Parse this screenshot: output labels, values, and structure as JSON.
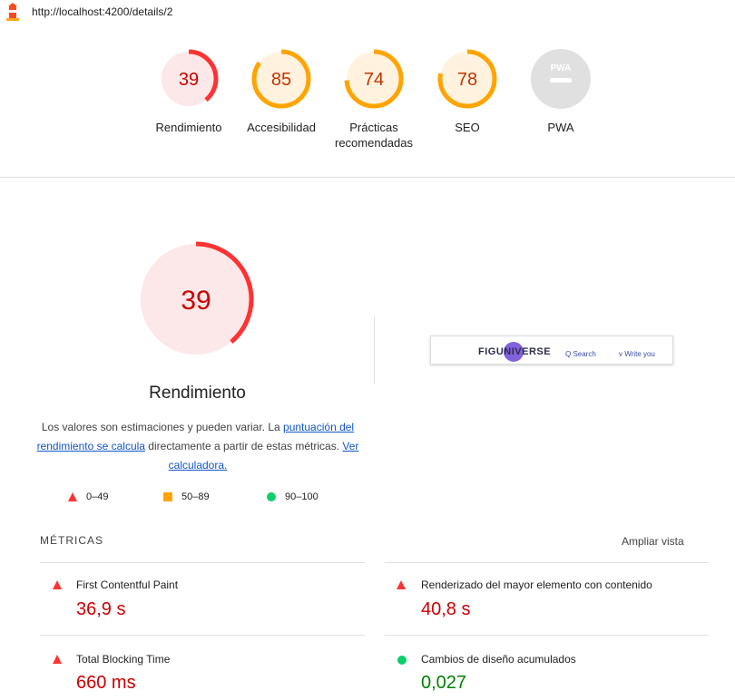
{
  "browser": {
    "url": "http://localhost:4200/details/2"
  },
  "gauges": [
    {
      "id": "rendimiento",
      "score": "39",
      "label": "Rendimiento",
      "fraction": 0.39,
      "color": "#ff3333",
      "bg": "#fce8e8",
      "text_color": "#c00"
    },
    {
      "id": "accesibilidad",
      "score": "85",
      "label": "Accesibilidad",
      "fraction": 0.85,
      "color": "#ffa400",
      "bg": "#fff3e0",
      "text_color": "#c33300"
    },
    {
      "id": "practicas",
      "score": "74",
      "label": "Prácticas recomendadas",
      "fraction": 0.74,
      "color": "#ffa400",
      "bg": "#fff3e0",
      "text_color": "#c33300"
    },
    {
      "id": "seo",
      "score": "78",
      "label": "SEO",
      "fraction": 0.78,
      "color": "#ffa400",
      "bg": "#fff3e0",
      "text_color": "#c33300"
    },
    {
      "id": "pwa",
      "score": "PWA",
      "label": "PWA",
      "fraction": 0,
      "color": "#cccccc",
      "bg": "#e0e0e0",
      "text_color": "#fff"
    }
  ],
  "performance": {
    "score": "39",
    "fraction": 0.39,
    "title": "Rendimiento",
    "desc_part1": "Los valores son estimaciones y pueden variar. La ",
    "desc_link1": "puntuación del rendimiento se calcula",
    "desc_part2": " directamente a partir de estas métricas. ",
    "desc_link2": "Ver calculadora."
  },
  "legend": {
    "fail": "0–49",
    "average": "50–89",
    "pass": "90–100"
  },
  "screenshot": {
    "brand": "FIGUNIVERSE",
    "search": "Q Search",
    "write": "v Write you"
  },
  "metrics": {
    "section_title": "MÉTRICAS",
    "expand_label": "Ampliar vista",
    "items": [
      {
        "label": "First Contentful Paint",
        "value": "36,9 s",
        "status": "fail"
      },
      {
        "label": "Renderizado del mayor elemento con contenido",
        "value": "40,8 s",
        "status": "fail"
      },
      {
        "label": "Total Blocking Time",
        "value": "660 ms",
        "status": "fail"
      },
      {
        "label": "Cambios de diseño acumulados",
        "value": "0,027",
        "status": "pass"
      }
    ]
  },
  "colors": {
    "fail": "#ff3333",
    "average": "#ffa400",
    "pass": "#0cce6b",
    "link": "#1155cc"
  }
}
